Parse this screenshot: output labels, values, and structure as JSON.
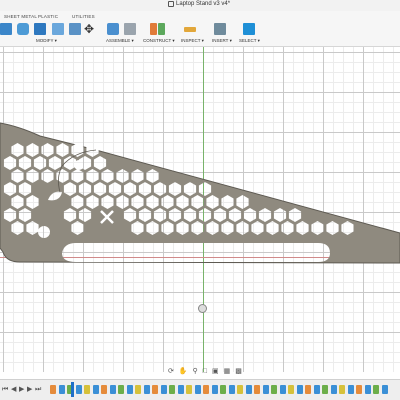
{
  "window": {
    "title": "Laptop Stand v3 v4*"
  },
  "toolbar": {
    "tabs": [
      "SHEET METAL",
      "PLASTIC",
      "UTILITIES"
    ],
    "groups": {
      "modify": "MODIFY ▾",
      "assemble": "ASSEMBLE ▾",
      "construct": "CONSTRUCT ▾",
      "inspect": "INSPECT ▾",
      "insert": "INSERT ▾",
      "select": "SELECT ▾"
    }
  },
  "colors": {
    "part_fill": "#8f8a7f",
    "part_edge": "#5e5a52",
    "accent": "#0a6fb8",
    "timeline_marker": "#1e6fc7"
  },
  "icons": {
    "navigation": [
      "orbit-icon",
      "pan-icon",
      "zoom-icon",
      "fit-icon",
      "display-settings-icon",
      "grid-icon",
      "viewports-icon"
    ],
    "timeline": [
      "first-step-icon",
      "previous-step-icon",
      "play-icon",
      "next-step-icon",
      "last-step-icon"
    ]
  }
}
